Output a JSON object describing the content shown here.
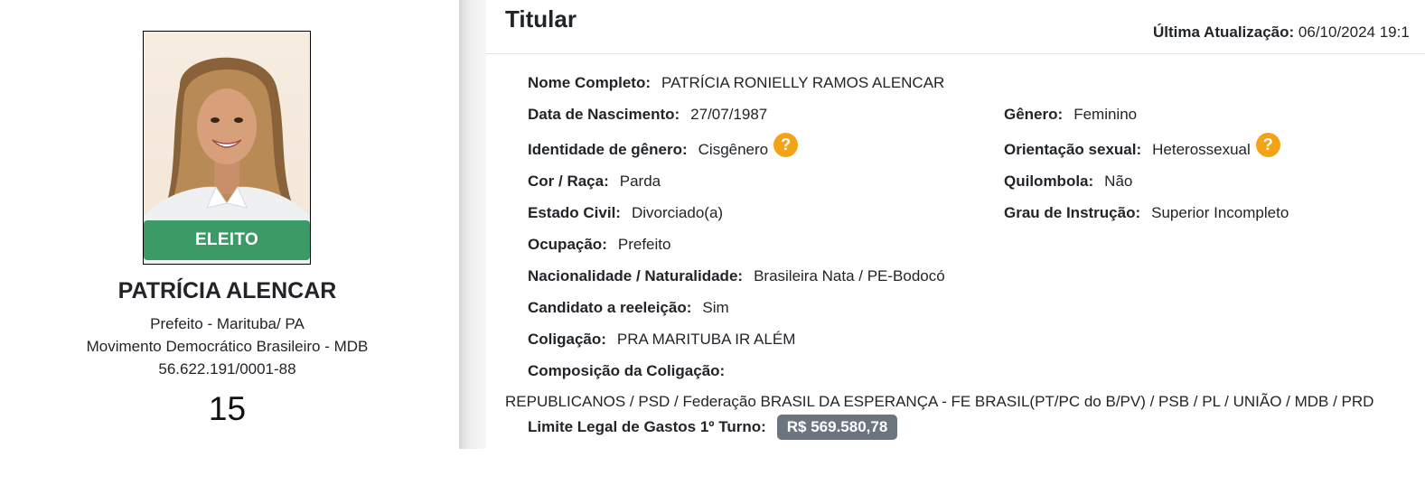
{
  "candidate": {
    "status_badge": "ELEITO",
    "name": "PATRÍCIA ALENCAR",
    "office_city": "Prefeito - Marituba/ PA",
    "party": "Movimento Democrático Brasileiro - MDB",
    "cnpj": "56.622.191/0001-88",
    "number": "15",
    "colors": {
      "badge": "#3b9a66"
    }
  },
  "panel": {
    "title": "Titular",
    "last_update_label": "Última Atualização:",
    "last_update_value": "06/10/2024 19:1",
    "fields": {
      "nome_completo": {
        "label": "Nome Completo:",
        "value": "PATRÍCIA RONIELLY RAMOS ALENCAR"
      },
      "data_nascimento": {
        "label": "Data de Nascimento:",
        "value": "27/07/1987"
      },
      "genero": {
        "label": "Gênero:",
        "value": "Feminino"
      },
      "identidade_genero": {
        "label": "Identidade de gênero:",
        "value": "Cisgênero"
      },
      "orientacao_sexual": {
        "label": "Orientação sexual:",
        "value": "Heterossexual"
      },
      "cor_raca": {
        "label": "Cor / Raça:",
        "value": "Parda"
      },
      "quilombola": {
        "label": "Quilombola:",
        "value": "Não"
      },
      "estado_civil": {
        "label": "Estado Civil:",
        "value": "Divorciado(a)"
      },
      "grau_instrucao": {
        "label": "Grau de Instrução:",
        "value": "Superior Incompleto"
      },
      "ocupacao": {
        "label": "Ocupação:",
        "value": "Prefeito"
      },
      "nacionalidade": {
        "label": "Nacionalidade / Naturalidade:",
        "value": "Brasileira Nata / PE-Bodocó"
      },
      "reeleicao": {
        "label": "Candidato a reeleição:",
        "value": "Sim"
      },
      "coligacao": {
        "label": "Coligação:",
        "value": "PRA MARITUBA IR ALÉM"
      },
      "composicao": {
        "label": "Composição da Coligação:",
        "value": "REPUBLICANOS / PSD / Federação BRASIL DA ESPERANÇA - FE BRASIL(PT/PC do B/PV) / PSB / PL / UNIÃO / MDB / PRD"
      },
      "limite_gastos": {
        "label": "Limite Legal de Gastos 1º Turno:",
        "value": "R$ 569.580,78"
      }
    },
    "help_icon_glyph": "?",
    "colors": {
      "help": "#f5a316",
      "money_badge": "#6c757d"
    }
  }
}
